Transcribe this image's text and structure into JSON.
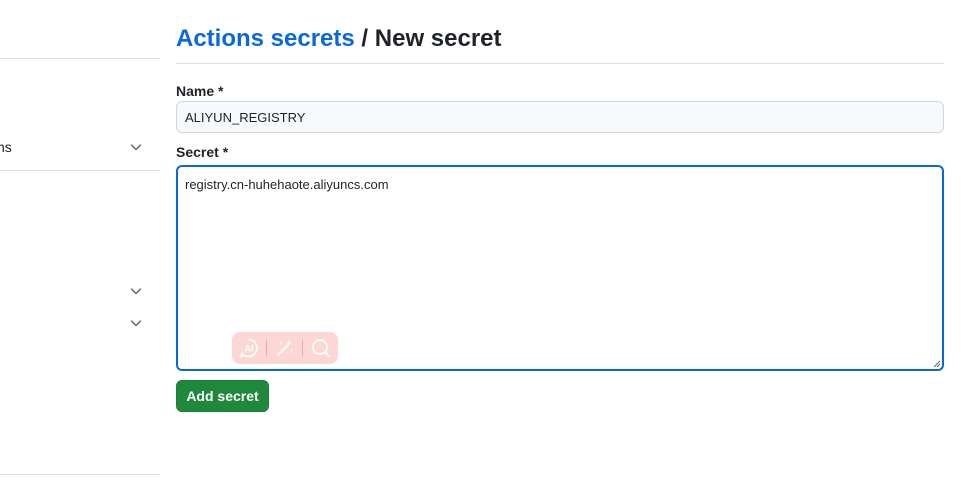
{
  "sidebar": {
    "items": [
      {
        "label": "ns",
        "expandable": true
      },
      {
        "label": "",
        "expandable": true
      },
      {
        "label": "",
        "expandable": true
      }
    ]
  },
  "header": {
    "parent_link": "Actions secrets",
    "separator": "/",
    "current": "New secret"
  },
  "form": {
    "name_label": "Name *",
    "name_value": "ALIYUN_REGISTRY",
    "secret_label": "Secret *",
    "secret_value": "registry.cn-huhehaote.aliyuncs.com",
    "submit_label": "Add secret"
  },
  "ai_toolbar": {
    "icons": [
      "ai-assistant-icon",
      "magic-wand-icon",
      "search-icon"
    ]
  },
  "colors": {
    "link": "#0969da",
    "primary_button": "#1f883d",
    "focus_border": "#0969da",
    "ai_toolbar_bg": "#fdd5d2"
  }
}
